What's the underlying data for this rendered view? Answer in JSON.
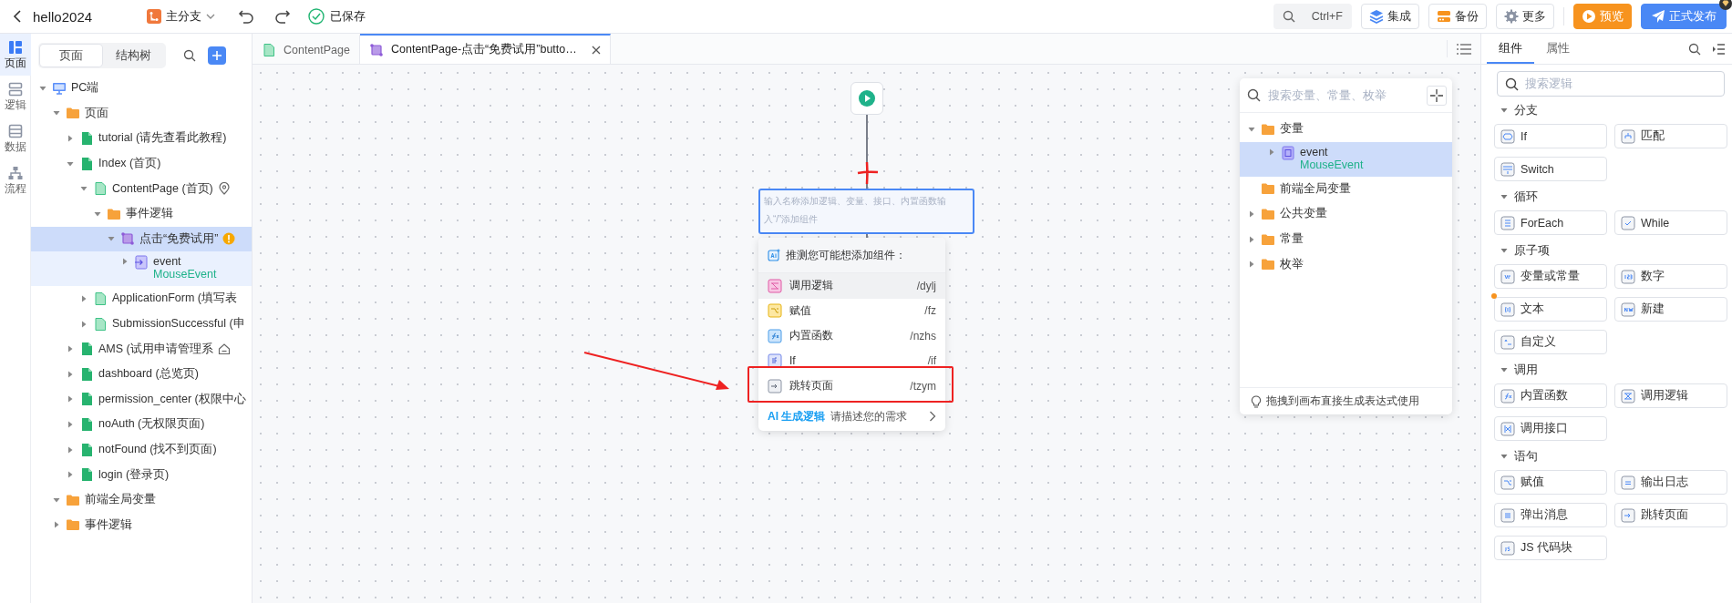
{
  "topbar": {
    "project_name": "hello2024",
    "branch": "主分支",
    "save_status": "已保存",
    "search_shortcut": "Ctrl+F",
    "buttons": [
      {
        "label": "集成",
        "kind": "integration"
      },
      {
        "label": "备份",
        "kind": "backup"
      },
      {
        "label": "更多",
        "kind": "more"
      },
      {
        "label": "预览",
        "kind": "preview"
      },
      {
        "label": "正式发布",
        "kind": "publish"
      }
    ]
  },
  "rail": [
    {
      "label": "页面",
      "kind": "pages",
      "selected": true
    },
    {
      "label": "逻辑",
      "kind": "logic",
      "selected": false
    },
    {
      "label": "数据",
      "kind": "data",
      "selected": false
    },
    {
      "label": "流程",
      "kind": "flow",
      "selected": false
    }
  ],
  "left_panel": {
    "tabs": [
      {
        "label": "页面",
        "selected": true
      },
      {
        "label": "结构树",
        "selected": false
      }
    ],
    "tree": [
      {
        "name": "PC端",
        "kind": "device",
        "expanded": true,
        "selected": false,
        "children": [
          {
            "name": "页面",
            "kind": "folder",
            "expanded": true,
            "selected": false,
            "children": [
              {
                "name": "tutorial (请先查看此教程)",
                "kind": "page",
                "expanded": false,
                "selected": false
              },
              {
                "name": "Index (首页)",
                "kind": "page",
                "expanded": true,
                "selected": false,
                "children": [
                  {
                    "name": "ContentPage (首页)",
                    "kind": "subpage",
                    "marker": {
                      "kind": "location"
                    },
                    "expanded": true,
                    "selected": false,
                    "children": [
                      {
                        "name": "事件逻辑",
                        "kind": "folder",
                        "expanded": true,
                        "selected": false,
                        "children": [
                          {
                            "name": "点击“免费试用”",
                            "kind": "logic",
                            "marker": {
                              "kind": "warning"
                            },
                            "expanded": true,
                            "selected": true,
                            "children": [
                              {
                                "name": "event",
                                "subtitle": "MouseEvent",
                                "kind": "param",
                                "expanded": false,
                                "selected": false
                              }
                            ]
                          }
                        ]
                      }
                    ]
                  },
                  {
                    "name": "ApplicationForm (填写表",
                    "kind": "subpage",
                    "expanded": false,
                    "selected": false
                  },
                  {
                    "name": "SubmissionSuccessful (申",
                    "kind": "subpage",
                    "expanded": false,
                    "selected": false
                  }
                ]
              },
              {
                "name": "AMS (试用申请管理系",
                "kind": "page",
                "marker": {
                  "kind": "home"
                },
                "expanded": false,
                "selected": false
              },
              {
                "name": "dashboard (总览页)",
                "kind": "page",
                "expanded": false,
                "selected": false
              },
              {
                "name": "permission_center (权限中心",
                "kind": "page",
                "expanded": false,
                "selected": false
              },
              {
                "name": "noAuth (无权限页面)",
                "kind": "page",
                "expanded": false,
                "selected": false
              },
              {
                "name": "notFound (找不到页面)",
                "kind": "page",
                "expanded": false,
                "selected": false
              },
              {
                "name": "login (登录页)",
                "kind": "page",
                "expanded": false,
                "selected": false
              }
            ]
          },
          {
            "name": "前端全局变量",
            "kind": "folder",
            "expanded": true,
            "selected": false
          },
          {
            "name": "事件逻辑",
            "kind": "folder",
            "expanded": false,
            "selected": false
          }
        ]
      }
    ]
  },
  "editor_tabs": [
    {
      "label": "ContentPage",
      "kind": "page",
      "selected": false,
      "closable": false
    },
    {
      "label": "ContentPage-点击“免费试用”butto…",
      "kind": "logic",
      "selected": true,
      "closable": true
    }
  ],
  "canvas": {
    "input": {
      "placeholder": "输入名称添加逻辑、变量、接口、内置函数输入“/”添加组件"
    },
    "suggestions": {
      "title": "推测您可能想添加组件：",
      "items": [
        {
          "label": "调用逻辑",
          "shortcut": "/dylj",
          "kind": "call-logic",
          "selected": true
        },
        {
          "label": "赋值",
          "shortcut": "/fz",
          "kind": "assign",
          "selected": false
        },
        {
          "label": "内置函数",
          "shortcut": "/nzhs",
          "kind": "function",
          "selected": false
        },
        {
          "label": "If",
          "shortcut": "/if",
          "kind": "if",
          "selected": false
        },
        {
          "label": "跳转页面",
          "shortcut": "/tzym",
          "kind": "navigate",
          "selected": false
        }
      ],
      "ai_link": "AI 生成逻辑",
      "ai_hint": "请描述您的需求"
    },
    "variables": {
      "placeholder": "搜索变量、常量、枚举",
      "tree": [
        {
          "name": "变量",
          "kind": "folder",
          "expanded": true,
          "selected": false,
          "children": [
            {
              "name": "event",
              "subtitle": "MouseEvent",
              "kind": "local",
              "expanded": false,
              "selected": true
            }
          ]
        },
        {
          "name": "前端全局变量",
          "kind": "folder",
          "selected": false
        },
        {
          "name": "公共变量",
          "kind": "folder",
          "expanded": false,
          "selected": false
        },
        {
          "name": "常量",
          "kind": "folder",
          "expanded": false,
          "selected": false
        },
        {
          "name": "枚举",
          "kind": "folder",
          "expanded": false,
          "selected": false
        }
      ],
      "hint": "拖拽到画布直接生成表达式使用"
    }
  },
  "right_panel": {
    "tabs": [
      {
        "label": "组件",
        "selected": true
      },
      {
        "label": "属性",
        "selected": false
      }
    ],
    "search": {
      "placeholder": "搜索逻辑"
    },
    "sections": [
      {
        "title": "分支",
        "expanded": true,
        "items": [
          {
            "label": "If",
            "kind": "if",
            "marked": false
          },
          {
            "label": "匹配",
            "kind": "match",
            "marked": false
          },
          {
            "label": "Switch",
            "kind": "switch",
            "marked": false
          }
        ]
      },
      {
        "title": "循环",
        "expanded": true,
        "items": [
          {
            "label": "ForEach",
            "kind": "foreach",
            "marked": false
          },
          {
            "label": "While",
            "kind": "while",
            "marked": false
          }
        ]
      },
      {
        "title": "原子项",
        "expanded": true,
        "items": [
          {
            "label": "变量或常量",
            "kind": "variable",
            "marked": false
          },
          {
            "label": "数字",
            "kind": "number",
            "marked": false
          },
          {
            "label": "文本",
            "kind": "text",
            "marked": true
          },
          {
            "label": "新建",
            "kind": "new",
            "marked": false
          },
          {
            "label": "自定义",
            "kind": "custom",
            "marked": false
          }
        ]
      },
      {
        "title": "调用",
        "expanded": true,
        "items": [
          {
            "label": "内置函数",
            "kind": "function",
            "marked": false
          },
          {
            "label": "调用逻辑",
            "kind": "call-logic",
            "marked": false
          },
          {
            "label": "调用接口",
            "kind": "call-api",
            "marked": false
          }
        ]
      },
      {
        "title": "语句",
        "expanded": true,
        "items": [
          {
            "label": "赋值",
            "kind": "assign",
            "marked": false
          },
          {
            "label": "输出日志",
            "kind": "log",
            "marked": false
          },
          {
            "label": "弹出消息",
            "kind": "message",
            "marked": false
          },
          {
            "label": "跳转页面",
            "kind": "navigate",
            "marked": false
          },
          {
            "label": "JS 代码块",
            "kind": "js",
            "marked": false
          }
        ]
      }
    ]
  }
}
